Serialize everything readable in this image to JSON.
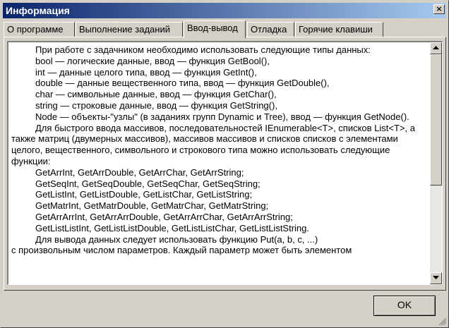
{
  "window": {
    "title": "Информация",
    "close_glyph": "×"
  },
  "tabs": [
    {
      "label": "О программе"
    },
    {
      "label": "Выполнение заданий"
    },
    {
      "label": "Ввод-вывод"
    },
    {
      "label": "Отладка"
    },
    {
      "label": "Горячие клавиши"
    }
  ],
  "active_tab": "Ввод-вывод",
  "content": {
    "lines": [
      "При работе с задачником необходимо использовать следующие типы данных:",
      "bool — логические данные, ввод — функция GetBool(),",
      "int — данные целого типа, ввод — функция GetInt(),",
      "double — данные вещественного типа, ввод — функция GetDouble(),",
      "char — символьные данные, ввод — функция GetChar(),",
      "string — строковые данные, ввод — функция GetString(),",
      "Node — объекты-\"узлы\" (в заданиях групп Dynamic и Tree), ввод — функция GetNode().",
      "Для быстрого ввода массивов, последовательностей IEnumerable<T>, списков List<T>, а также матриц (двумерных массивов), массивов массивов и списков списков с элементами целого, вещественного, символьного и строкового типа можно использовать следующие функции:",
      "GetArrInt, GetArrDouble, GetArrChar, GetArrString;",
      "GetSeqInt, GetSeqDouble, GetSeqChar, GetSeqString;",
      "GetListInt, GetListDouble, GetListChar, GetListString;",
      "GetMatrInt, GetMatrDouble, GetMatrChar, GetMatrString;",
      "GetArrArrInt, GetArrArrDouble, GetArrArrChar, GetArrArrString;",
      "GetListListInt, GetListListDouble, GetListListChar, GetListListString.",
      "Для вывода данных следует использовать функцию Put(a, b, c, ...)",
      "с произвольным числом параметров. Каждый параметр может быть элементом"
    ]
  },
  "buttons": {
    "ok_label": "OK"
  },
  "icons": {
    "scroll_up": "up-arrow-icon",
    "scroll_down": "down-arrow-icon",
    "resize_grip": "resize-grip-icon"
  },
  "colors": {
    "title_gradient_start": "#0a246a",
    "title_gradient_end": "#a6caf0",
    "face": "#d4d0c8"
  }
}
